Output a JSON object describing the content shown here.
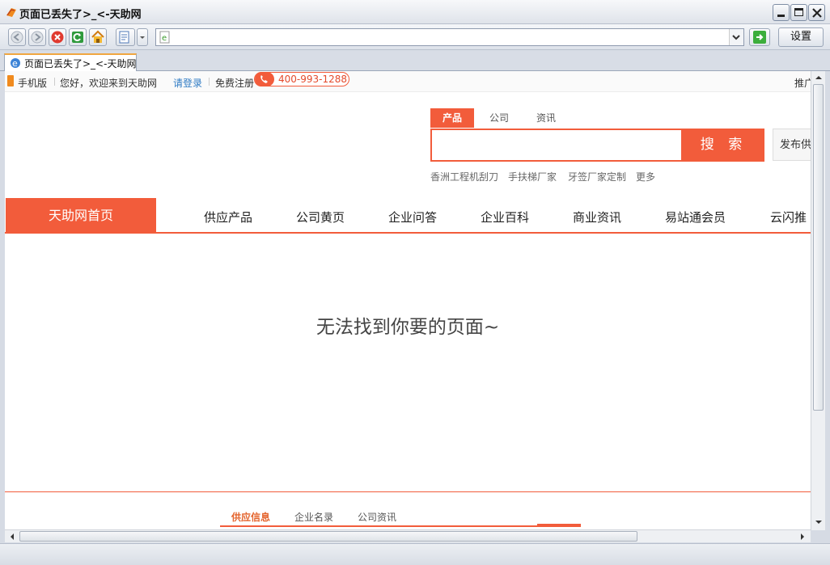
{
  "window": {
    "title": "页面已丢失了>_<-天助网"
  },
  "toolbar": {
    "settings_label": "设置",
    "address_value": ""
  },
  "tab": {
    "label": "页面已丢失了>_<-天助网"
  },
  "topbar": {
    "mobile": "手机版",
    "welcome": "您好，欢迎来到天助网",
    "login": "请登录",
    "register": "免费注册",
    "phone": "400-993-1288",
    "promo": "推广"
  },
  "search": {
    "tabs": [
      "产品",
      "公司",
      "资讯"
    ],
    "placeholder": "",
    "button": "搜 索",
    "publish": "发布供",
    "hot_keywords": [
      "香洲工程机刮刀",
      "手扶梯厂家",
      "牙签厂家定制",
      "更多"
    ]
  },
  "nav": {
    "home": "天助网首页",
    "items": [
      "供应产品",
      "公司黄页",
      "企业问答",
      "企业百科",
      "商业资讯",
      "易站通会员",
      "云闪推"
    ]
  },
  "message": "无法找到你要的页面~",
  "footer": {
    "tabs": [
      "供应信息",
      "企业名录",
      "公司资讯"
    ]
  },
  "colors": {
    "accent": "#f25c3b"
  }
}
